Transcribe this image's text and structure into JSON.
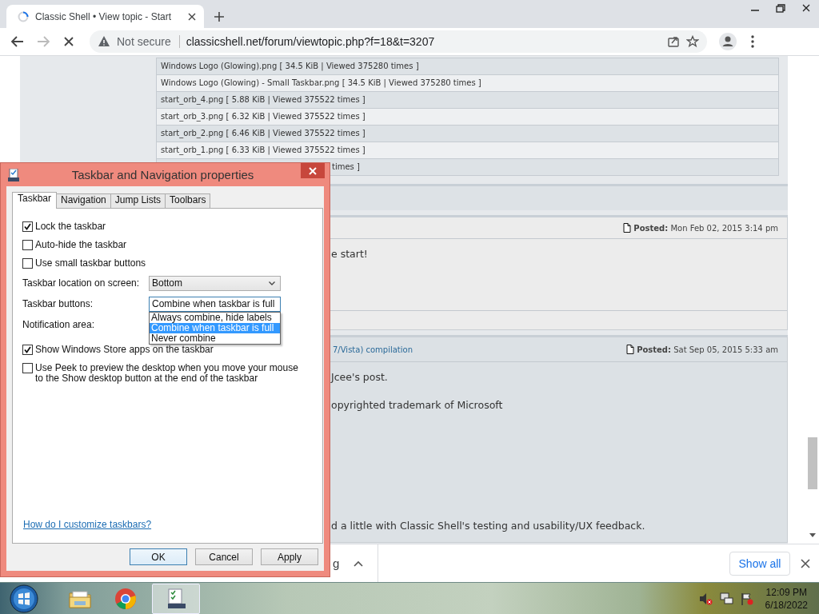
{
  "browser": {
    "tab_title": "Classic Shell • View topic - Start",
    "loading": true,
    "security_label": "Not secure",
    "url": "classicshell.net/forum/viewtopic.php?f=18&t=3207"
  },
  "attachments": [
    "Windows Logo (Glowing).png [ 34.5 KiB | Viewed 375280 times ]",
    "Windows Logo (Glowing) - Small Taskbar.png [ 34.5 KiB | Viewed 375280 times ]",
    "start_orb_4.png [ 5.88 KiB | Viewed 375522 times ]",
    "start_orb_3.png [ 6.32 KiB | Viewed 375522 times ]",
    "start_orb_2.png [ 6.46 KiB | Viewed 375522 times ]",
    "start_orb_1.png [ 6.33 KiB | Viewed 375522 times ]",
    "times ]"
  ],
  "posts": [
    {
      "posted": "**Posted:** Mon Feb 02, 2015 3:14 pm",
      "body": [
        "e start!"
      ]
    },
    {
      "title": "7/Vista) compilation",
      "posted": "**Posted:** Sat Sep 05, 2015 5:33 am",
      "body": [
        "Jcee's post.",
        "opyrighted trademark of Microsoft",
        "d a little with Classic Shell's testing and usability/UX feedback."
      ]
    }
  ],
  "downloads_bar": {
    "item_text": "g",
    "show_all": "Show all"
  },
  "dialog": {
    "title": "Taskbar and Navigation properties",
    "tabs": [
      {
        "label": "Taskbar",
        "selected": true
      },
      {
        "label": "Navigation",
        "selected": false
      },
      {
        "label": "Jump Lists",
        "selected": false
      },
      {
        "label": "Toolbars",
        "selected": false
      }
    ],
    "settings": [
      {
        "kind": "checkbox",
        "label": "Lock the taskbar",
        "checked": true
      },
      {
        "kind": "checkbox",
        "label": "Auto-hide the taskbar",
        "checked": false
      },
      {
        "kind": "checkbox",
        "label": "Use small taskbar buttons",
        "checked": false
      },
      {
        "kind": "select",
        "label": "Taskbar location on screen:",
        "value": "Bottom",
        "focused": false
      },
      {
        "kind": "select",
        "label": "Taskbar buttons:",
        "value": "Combine when taskbar is full",
        "focused": true,
        "options": [
          {
            "label": "Always combine, hide labels",
            "selected": false
          },
          {
            "label": "Combine when taskbar is full",
            "selected": true
          },
          {
            "label": "Never combine",
            "selected": false
          }
        ]
      },
      {
        "kind": "label",
        "label": "Notification area:"
      },
      {
        "kind": "checkbox",
        "label": "Show Windows Store apps on the taskbar",
        "checked": true
      },
      {
        "kind": "checkbox",
        "label": "Use Peek to preview the desktop when you move your mouse to the Show desktop button at the end of the taskbar",
        "checked": false
      }
    ],
    "help_link": "How do I customize taskbars?",
    "buttons": [
      {
        "label": "OK",
        "default": true
      },
      {
        "label": "Cancel",
        "default": false
      },
      {
        "label": "Apply",
        "default": false
      }
    ]
  },
  "taskbar": {
    "apps": [
      {
        "kind": "folder",
        "active": false
      },
      {
        "kind": "browser",
        "active": false
      },
      {
        "kind": "settings",
        "active": true
      }
    ],
    "time": "12:09 PM",
    "date": "6/18/2022"
  }
}
